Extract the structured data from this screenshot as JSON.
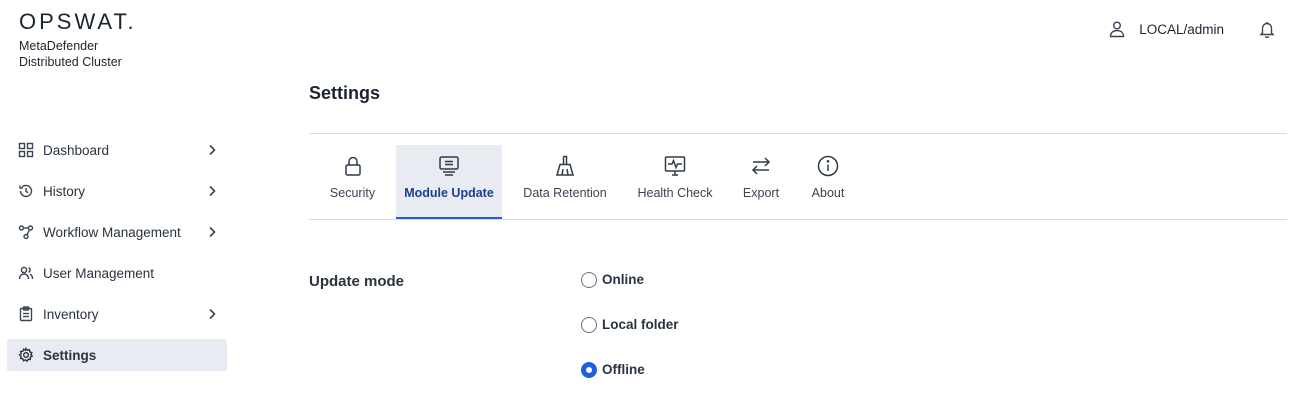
{
  "brand": {
    "logo_text": "OPSWAT.",
    "product_line1": "MetaDefender",
    "product_line2": "Distributed Cluster"
  },
  "header": {
    "user_label": "LOCAL/admin",
    "user_icon": "user-icon",
    "notifications_icon": "bell-icon"
  },
  "sidebar": {
    "items": [
      {
        "label": "Dashboard",
        "icon": "grid-icon",
        "has_submenu": true
      },
      {
        "label": "History",
        "icon": "history-icon",
        "has_submenu": true
      },
      {
        "label": "Workflow Management",
        "icon": "workflow-icon",
        "has_submenu": true
      },
      {
        "label": "User Management",
        "icon": "users-icon",
        "has_submenu": false
      },
      {
        "label": "Inventory",
        "icon": "clipboard-icon",
        "has_submenu": true
      },
      {
        "label": "Settings",
        "icon": "gear-icon",
        "has_submenu": false,
        "active": true
      }
    ]
  },
  "page": {
    "title": "Settings"
  },
  "tabs": [
    {
      "label": "Security",
      "icon": "lock-icon"
    },
    {
      "label": "Module Update",
      "icon": "module-update-icon",
      "active": true
    },
    {
      "label": "Data Retention",
      "icon": "broom-icon"
    },
    {
      "label": "Health Check",
      "icon": "monitor-pulse-icon"
    },
    {
      "label": "Export",
      "icon": "arrows-exchange-icon"
    },
    {
      "label": "About",
      "icon": "info-icon"
    }
  ],
  "update_mode": {
    "label": "Update mode",
    "options": [
      {
        "label": "Online",
        "checked": false
      },
      {
        "label": "Local folder",
        "checked": false
      },
      {
        "label": "Offline",
        "checked": true
      }
    ],
    "selected": "Offline"
  },
  "colors": {
    "accent": "#1d5fe0",
    "active_bg": "#e8ebf2",
    "text": "#1b2430",
    "divider": "#d9dde3"
  }
}
